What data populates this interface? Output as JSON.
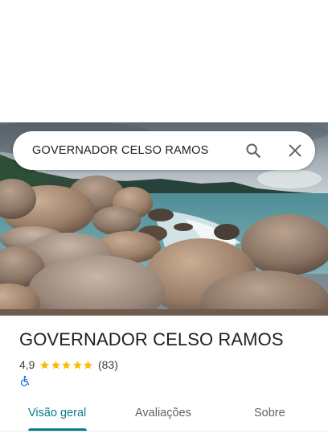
{
  "search": {
    "query": "GOVERNADOR CELSO RAMOS"
  },
  "place": {
    "title": "GOVERNADOR CELSO RAMOS",
    "rating": "4,9",
    "stars": 5,
    "review_count": "(83)",
    "accessibility": "wheelchair-accessible-icon"
  },
  "tabs": [
    {
      "label": "Visão geral",
      "active": true
    },
    {
      "label": "Avaliações",
      "active": false
    },
    {
      "label": "Sobre",
      "active": false
    }
  ],
  "colors": {
    "accent": "#0b7a8a",
    "star": "#fbbc04",
    "accessibility": "#1a73e8"
  }
}
